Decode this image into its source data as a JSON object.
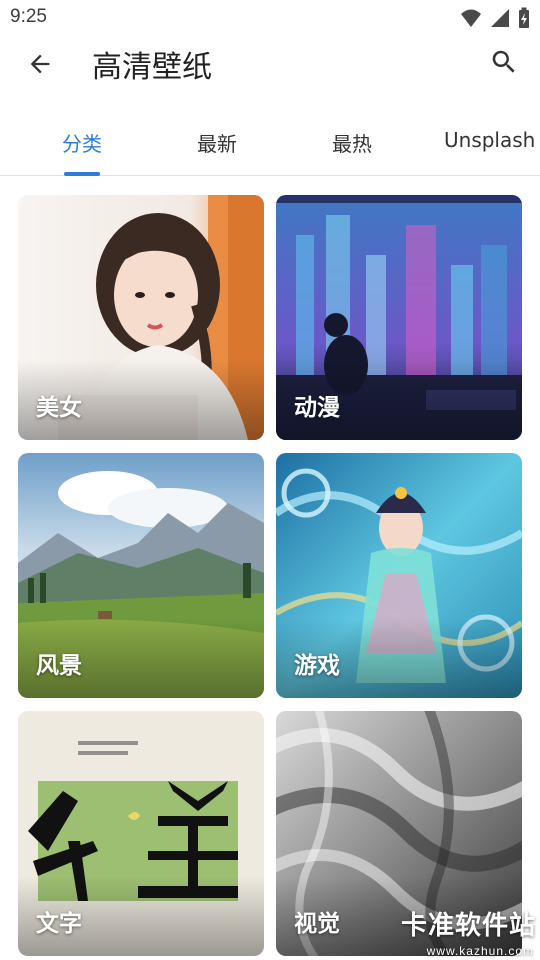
{
  "status_bar": {
    "time": "9:25",
    "icons": [
      "wifi-icon",
      "signal-icon",
      "battery-charging-icon"
    ]
  },
  "app_bar": {
    "title": "高清壁纸",
    "back_icon": "arrow-left-icon",
    "search_icon": "search-icon"
  },
  "tabs": [
    {
      "label": "分类",
      "active": true
    },
    {
      "label": "最新",
      "active": false
    },
    {
      "label": "最热",
      "active": false
    },
    {
      "label": "Unsplash",
      "active": false
    }
  ],
  "accent_color": "#2f7bd8",
  "categories": [
    {
      "label": "美女"
    },
    {
      "label": "动漫"
    },
    {
      "label": "风景"
    },
    {
      "label": "游戏"
    },
    {
      "label": "文字"
    },
    {
      "label": "视觉"
    }
  ],
  "watermark": {
    "main": "卡准软件站",
    "sub": "www.kazhun.com"
  }
}
